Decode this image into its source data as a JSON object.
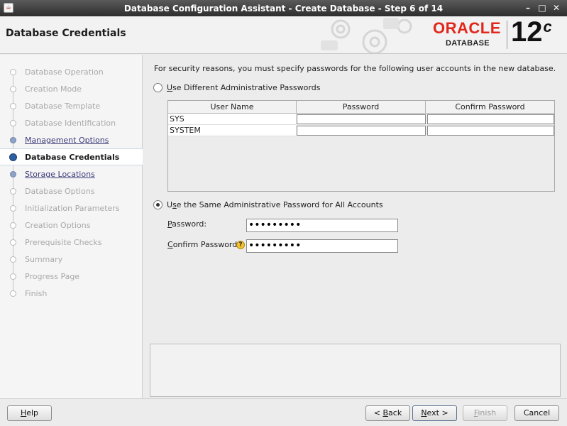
{
  "window": {
    "title": "Database Configuration Assistant - Create Database - Step 6 of 14",
    "controls": [
      "–",
      "□",
      "✕"
    ]
  },
  "header": {
    "title": "Database Credentials",
    "brand_name": "ORACLE",
    "brand_product": "DATABASE",
    "brand_version": "12",
    "brand_version_suffix": "c"
  },
  "sidebar": {
    "items": [
      {
        "label": "Database Operation",
        "state": "disabled"
      },
      {
        "label": "Creation Mode",
        "state": "disabled"
      },
      {
        "label": "Database Template",
        "state": "disabled"
      },
      {
        "label": "Database Identification",
        "state": "disabled"
      },
      {
        "label": "Management Options",
        "state": "done"
      },
      {
        "label": "Database Credentials",
        "state": "current"
      },
      {
        "label": "Storage Locations",
        "state": "next"
      },
      {
        "label": "Database Options",
        "state": "disabled"
      },
      {
        "label": "Initialization Parameters",
        "state": "disabled"
      },
      {
        "label": "Creation Options",
        "state": "disabled"
      },
      {
        "label": "Prerequisite Checks",
        "state": "disabled"
      },
      {
        "label": "Summary",
        "state": "disabled"
      },
      {
        "label": "Progress Page",
        "state": "disabled"
      },
      {
        "label": "Finish",
        "state": "disabled"
      }
    ]
  },
  "main": {
    "intro": "For security reasons, you must specify passwords for the following user accounts in the new database.",
    "option_different": {
      "mnemonic": "U",
      "label_rest": "se Different Administrative Passwords",
      "selected": false
    },
    "table": {
      "columns": [
        "User Name",
        "Password",
        "Confirm Password"
      ],
      "rows": [
        {
          "user": "SYS",
          "password": "",
          "confirm": ""
        },
        {
          "user": "SYSTEM",
          "password": "",
          "confirm": ""
        }
      ]
    },
    "option_same": {
      "label_pre": "U",
      "mnemonic": "s",
      "label_rest": "e the Same Administrative Password for All Accounts",
      "selected": true
    },
    "password": {
      "mnemonic": "P",
      "label_rest": "assword:",
      "value": "•••••••••"
    },
    "confirm_password": {
      "mnemonic": "C",
      "label_rest": "onfirm Password:",
      "value": "•••••••••"
    },
    "help_icon": "?"
  },
  "footer": {
    "help": {
      "mnemonic": "H",
      "label_rest": "elp"
    },
    "back": {
      "prefix": "< ",
      "mnemonic": "B",
      "label_rest": "ack"
    },
    "next": {
      "mnemonic": "N",
      "label_rest": "ext >"
    },
    "finish": {
      "mnemonic": "F",
      "label_rest": "inish"
    },
    "cancel": {
      "label": "Cancel"
    }
  },
  "colors": {
    "oracle_red": "#e1261c",
    "title_bar": "#3c3c3c",
    "current_step": "#2e5fa0"
  }
}
